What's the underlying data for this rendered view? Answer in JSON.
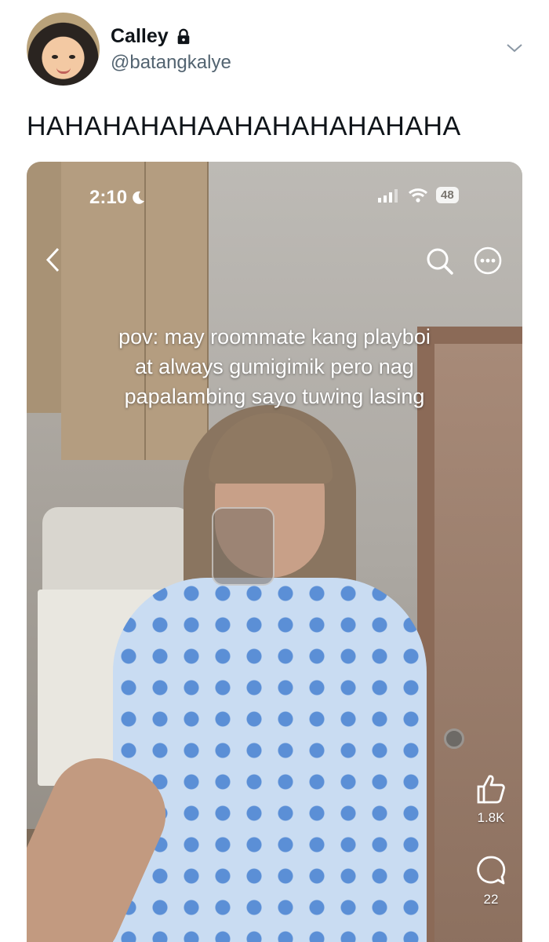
{
  "tweet": {
    "display_name": "Calley",
    "handle": "@batangkalye",
    "text": "HAHAHAHAHAAHAHAHAHAHAHA"
  },
  "media": {
    "status_time": "2:10",
    "battery": "48",
    "caption_lines": [
      "pov: may roommate kang playboi",
      "at always gumigimik pero nag",
      "papalambing sayo tuwing lasing"
    ],
    "likes": "1.8K",
    "comments": "22"
  },
  "icons": [
    "lock-icon",
    "chevron-down-icon",
    "moon-icon",
    "signal-icon",
    "wifi-icon",
    "back-icon",
    "search-icon",
    "more-icon",
    "like-icon",
    "comment-icon"
  ],
  "colors": {
    "text": "#0f1419",
    "secondary": "#536471",
    "overlay_text": "#ffffff"
  }
}
